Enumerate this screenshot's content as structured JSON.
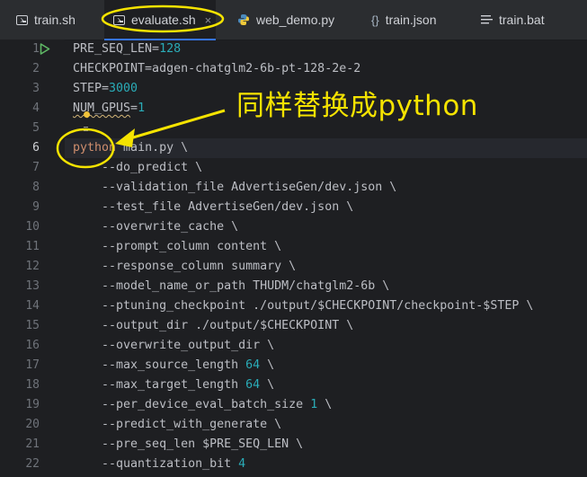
{
  "tabs": [
    {
      "label": "train.sh",
      "icon": "terminal-icon"
    },
    {
      "label": "evaluate.sh",
      "icon": "terminal-icon",
      "active": true,
      "close": "×"
    },
    {
      "label": "web_demo.py",
      "icon": "python-icon"
    },
    {
      "label": "train.json",
      "icon": "json-braces-icon"
    },
    {
      "label": "train.bat",
      "icon": "text-lines-icon"
    }
  ],
  "editor": {
    "current_line": 6,
    "lines": [
      {
        "n": "1",
        "text": "PRE_SEQ_LEN=128"
      },
      {
        "n": "2",
        "text": "CHECKPOINT=adgen-chatglm2-6b-pt-128-2e-2"
      },
      {
        "n": "3",
        "text": "STEP=3000"
      },
      {
        "n": "4",
        "text": "NUM_GPUS=1"
      },
      {
        "n": "5",
        "text": ""
      },
      {
        "n": "6",
        "text": "python main.py \\"
      },
      {
        "n": "7",
        "text": "    --do_predict \\"
      },
      {
        "n": "8",
        "text": "    --validation_file AdvertiseGen/dev.json \\"
      },
      {
        "n": "9",
        "text": "    --test_file AdvertiseGen/dev.json \\"
      },
      {
        "n": "10",
        "text": "    --overwrite_cache \\"
      },
      {
        "n": "11",
        "text": "    --prompt_column content \\"
      },
      {
        "n": "12",
        "text": "    --response_column summary \\"
      },
      {
        "n": "13",
        "text": "    --model_name_or_path THUDM/chatglm2-6b \\"
      },
      {
        "n": "14",
        "text": "    --ptuning_checkpoint ./output/$CHECKPOINT/checkpoint-$STEP \\"
      },
      {
        "n": "15",
        "text": "    --output_dir ./output/$CHECKPOINT \\"
      },
      {
        "n": "16",
        "text": "    --overwrite_output_dir \\"
      },
      {
        "n": "17",
        "text": "    --max_source_length 64 \\"
      },
      {
        "n": "18",
        "text": "    --max_target_length 64 \\"
      },
      {
        "n": "19",
        "text": "    --per_device_eval_batch_size 1 \\"
      },
      {
        "n": "20",
        "text": "    --predict_with_generate \\"
      },
      {
        "n": "21",
        "text": "    --pre_seq_len $PRE_SEQ_LEN \\"
      },
      {
        "n": "22",
        "text": "    --quantization_bit 4"
      }
    ]
  },
  "annotation": {
    "text": "同样替换成python",
    "color": "#f5e300"
  },
  "colors": {
    "background": "#1e1f22",
    "tabbar": "#2b2d30",
    "number": "#2aacb8",
    "keyword": "#cf8e6d",
    "annotation": "#f5e300"
  }
}
